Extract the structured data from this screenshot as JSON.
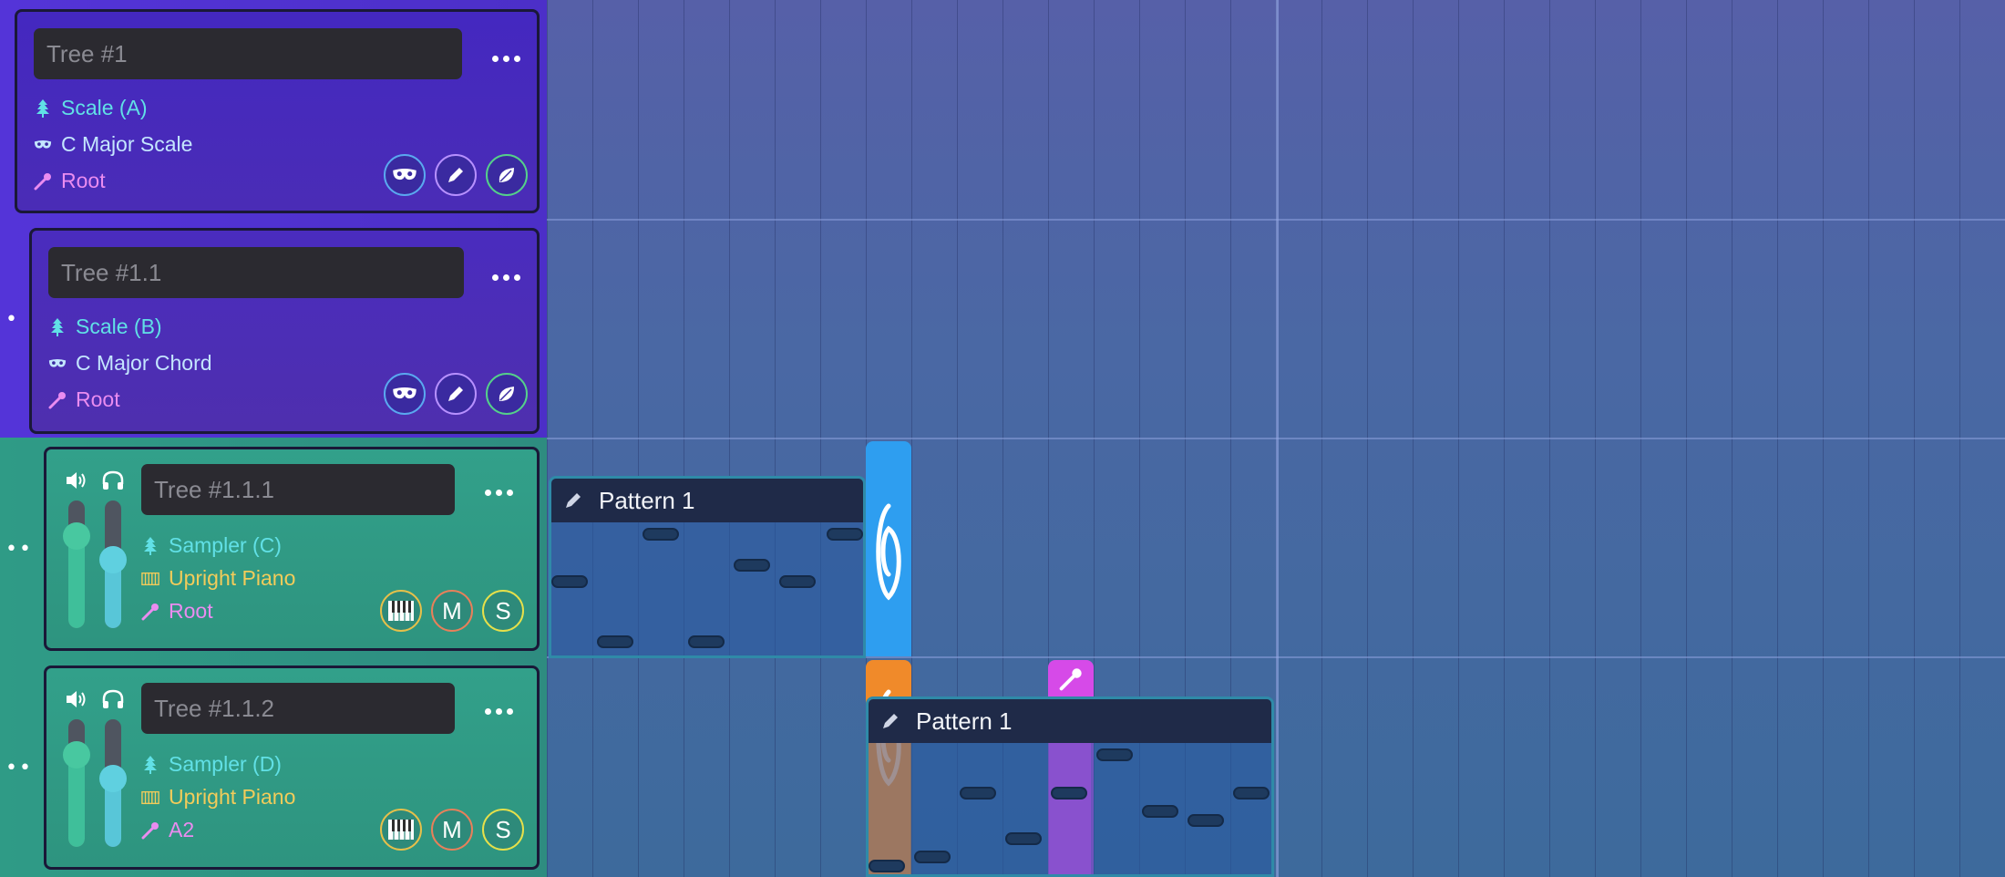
{
  "colors": {
    "purple_row": "#5434d8",
    "green_row": "#2f9b86",
    "timeline_bg": "#4b6aa6",
    "blue_marker": "#2e9ef0",
    "orange_marker": "#f08a2a",
    "magenta_marker": "#d64ae8"
  },
  "tracks": [
    {
      "name_placeholder": "Tree #1",
      "node": "Scale (A)",
      "content": "C Major Scale",
      "root": "Root",
      "buttons": [
        "mask-icon",
        "pencil-icon",
        "leaf-icon"
      ]
    },
    {
      "name_placeholder": "Tree #1.1",
      "node": "Scale (B)",
      "content": "C Major Chord",
      "root": "Root",
      "buttons": [
        "mask-icon",
        "pencil-icon",
        "leaf-icon"
      ]
    },
    {
      "name_placeholder": "Tree #1.1.1",
      "node": "Sampler (C)",
      "instrument": "Upright Piano",
      "root": "Root",
      "mute_label": "M",
      "solo_label": "S",
      "volume_level": 0.78,
      "monitor_level": 0.6
    },
    {
      "name_placeholder": "Tree #1.1.2",
      "node": "Sampler (D)",
      "instrument": "Upright Piano",
      "root": "A2",
      "mute_label": "M",
      "solo_label": "S",
      "volume_level": 0.78,
      "monitor_level": 0.6
    }
  ],
  "patterns": [
    {
      "title": "Pattern 1"
    },
    {
      "title": "Pattern 1"
    }
  ]
}
